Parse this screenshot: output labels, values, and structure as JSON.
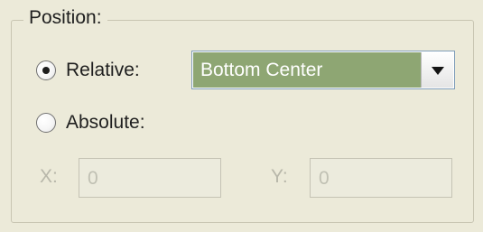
{
  "group": {
    "title": "Position:"
  },
  "options": {
    "relative": {
      "label": "Relative:",
      "selected": true
    },
    "absolute": {
      "label": "Absolute:",
      "selected": false
    }
  },
  "relative_select": {
    "value": "Bottom Center"
  },
  "coordinates": {
    "x_label": "X:",
    "x_value": "0",
    "y_label": "Y:",
    "y_value": "0"
  }
}
